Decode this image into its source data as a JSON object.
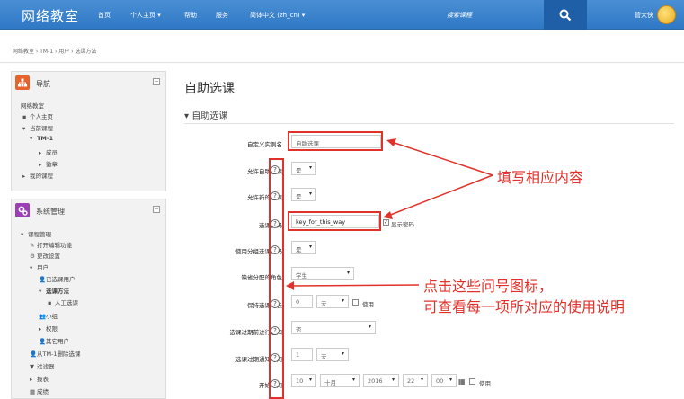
{
  "navbar": {
    "brand": "网络教室",
    "items": [
      "首页",
      "个人主页 ▾",
      "帮助",
      "服务",
      "简体中文 (zh_cn) ▾"
    ],
    "search_label": "搜索课程",
    "username": "管大侠"
  },
  "breadcrumb": "网络教室 › TM-1 › 用户 › 选课方法",
  "nav_block": {
    "title": "导航",
    "items": [
      "网络教室",
      "个人主页",
      "当前课程",
      "TM-1",
      "成员",
      "徽章",
      "我的课程"
    ]
  },
  "admin_block": {
    "title": "系统管理",
    "items": [
      "课程管理",
      "打开编辑功能",
      "更改设置",
      "用户",
      "已选课用户",
      "选课方法",
      "人工选课",
      "小组",
      "权限",
      "其它用户",
      "从TM-1删除选课",
      "过滤器",
      "报表",
      "成绩"
    ]
  },
  "page": {
    "heading": "自助选课",
    "section": "▾ 自助选课"
  },
  "form": {
    "custom_name_label": "自定义实例名",
    "custom_name_value": "自助选课",
    "allow_self_label": "允许自助选课",
    "allow_self_value": "是",
    "allow_new_label": "允许新的选课",
    "allow_new_value": "是",
    "enrol_key_label": "选课密码",
    "enrol_key_value": "key_for_this_way",
    "show_password_label": "显示密码",
    "group_key_label": "使用分组选课密码",
    "group_key_value": "是",
    "default_role_label": "缺省分配的角色",
    "default_role_value": "学生",
    "enrol_period_label": "保持选课时长",
    "enrol_period_value": "0",
    "enrol_period_unit": "天",
    "enrol_period_enable": "使用",
    "notify_label": "选课过期前进行通知",
    "notify_value": "否",
    "notify_threshold_label": "选课过期通知时间",
    "notify_threshold_value": "1",
    "notify_threshold_unit": "天",
    "start_label": "开始时间",
    "start_day": "10",
    "start_month": "十月",
    "start_year": "2016",
    "start_hour": "22",
    "start_minute": "00",
    "start_enable": "使用"
  },
  "annotations": {
    "fill_in": "填写相应内容",
    "help_line1": "点击这些问号图标，",
    "help_line2": "可查看每一项所对应的使用说明"
  },
  "colors": {
    "navbar": "#2f78c5",
    "annotation": "#e0322b"
  }
}
